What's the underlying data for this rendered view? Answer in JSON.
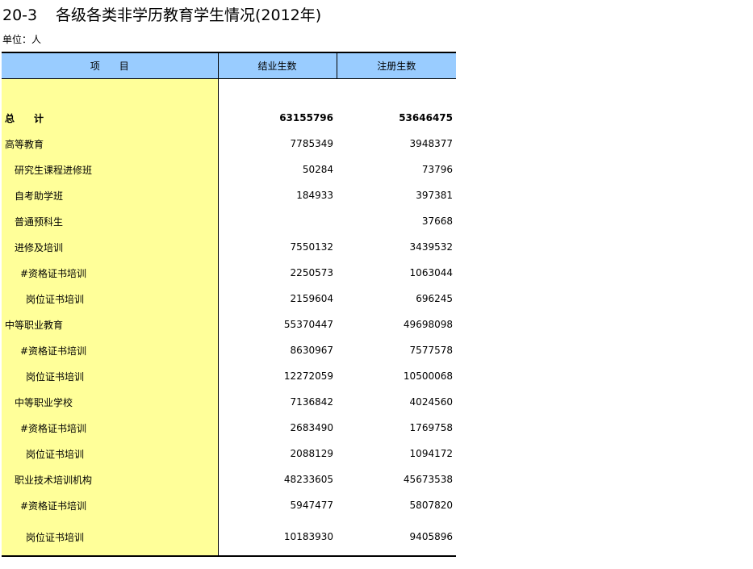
{
  "title": {
    "number": "20-3",
    "text": "各级各类非学历教育学生情况(2012年)"
  },
  "unit": "单位：人",
  "table": {
    "headers": [
      "项　　目",
      "结业生数",
      "注册生数"
    ],
    "rows": [
      {
        "label": "总　　计",
        "indent": 0,
        "bold": true,
        "graduates": "63155796",
        "registered": "53646475"
      },
      {
        "label": "高等教育",
        "indent": 0,
        "bold": false,
        "graduates": "7785349",
        "registered": "3948377"
      },
      {
        "label": "研究生课程进修班",
        "indent": 1,
        "bold": false,
        "graduates": "50284",
        "registered": "73796"
      },
      {
        "label": "自考助学班",
        "indent": 1,
        "bold": false,
        "graduates": "184933",
        "registered": "397381"
      },
      {
        "label": "普通预科生",
        "indent": 1,
        "bold": false,
        "graduates": "",
        "registered": "37668"
      },
      {
        "label": "进修及培训",
        "indent": 1,
        "bold": false,
        "graduates": "7550132",
        "registered": "3439532"
      },
      {
        "label": "#资格证书培训",
        "indent": 2,
        "bold": false,
        "graduates": "2250573",
        "registered": "1063044"
      },
      {
        "label": "岗位证书培训",
        "indent": 3,
        "bold": false,
        "graduates": "2159604",
        "registered": "696245"
      },
      {
        "label": "中等职业教育",
        "indent": 0,
        "bold": false,
        "graduates": "55370447",
        "registered": "49698098"
      },
      {
        "label": "#资格证书培训",
        "indent": 2,
        "bold": false,
        "graduates": "8630967",
        "registered": "7577578"
      },
      {
        "label": "岗位证书培训",
        "indent": 3,
        "bold": false,
        "graduates": "12272059",
        "registered": "10500068"
      },
      {
        "label": "中等职业学校",
        "indent": 1,
        "bold": false,
        "graduates": "7136842",
        "registered": "4024560"
      },
      {
        "label": "#资格证书培训",
        "indent": 2,
        "bold": false,
        "graduates": "2683490",
        "registered": "1769758"
      },
      {
        "label": "岗位证书培训",
        "indent": 3,
        "bold": false,
        "graduates": "2088129",
        "registered": "1094172"
      },
      {
        "label": "职业技术培训机构",
        "indent": 1,
        "bold": false,
        "graduates": "48233605",
        "registered": "45673538"
      },
      {
        "label": "#资格证书培训",
        "indent": 2,
        "bold": false,
        "graduates": "5947477",
        "registered": "5807820"
      },
      {
        "label": "岗位证书培训",
        "indent": 3,
        "bold": false,
        "graduates": "10183930",
        "registered": "9405896"
      }
    ]
  },
  "colors": {
    "header_bg": "#99ccff",
    "label_bg": "#ffff99"
  }
}
